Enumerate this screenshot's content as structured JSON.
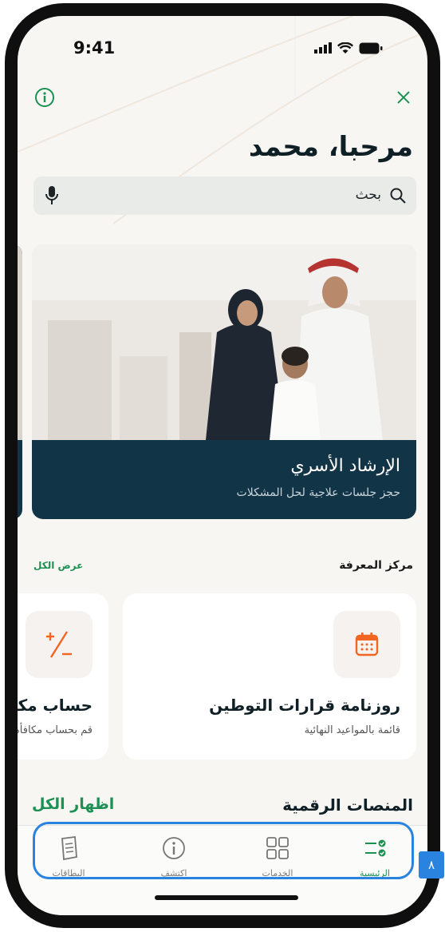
{
  "status_bar": {
    "time": "9:41"
  },
  "header": {
    "greeting": "مرحبا، محمد"
  },
  "search": {
    "placeholder": "بحث"
  },
  "featured_card": {
    "title": "الإرشاد الأسري",
    "subtitle": "حجز جلسات علاجية لحل المشكلات"
  },
  "knowledge_center": {
    "title": "مركز المعرفة",
    "view_all": "عرض الكل",
    "cards": [
      {
        "title": "روزنامة قرارات التوطين",
        "subtitle": "قائمة بالمواعيد النهائية",
        "icon": "calendar-icon"
      },
      {
        "title": "حساب مكافأة",
        "subtitle": "قم بحساب مكافأة",
        "icon": "plus-minus-icon"
      }
    ]
  },
  "digital_platforms": {
    "title": "المنصات الرقمية",
    "show_all": "اظهار الكل"
  },
  "tab_bar": {
    "tabs": [
      {
        "label": "الرئيسية",
        "icon": "home-checklist-icon",
        "active": true
      },
      {
        "label": "الخدمات",
        "icon": "grid-icon",
        "active": false
      },
      {
        "label": "اكتشف",
        "icon": "info-icon",
        "active": false
      },
      {
        "label": "البطاقات",
        "icon": "cards-icon",
        "active": false
      }
    ]
  },
  "annotation": {
    "badge": "٨"
  },
  "colors": {
    "accent": "#1c9154",
    "card_dark": "#123447",
    "highlight": "#2a83df",
    "icon_orange": "#f26522"
  }
}
